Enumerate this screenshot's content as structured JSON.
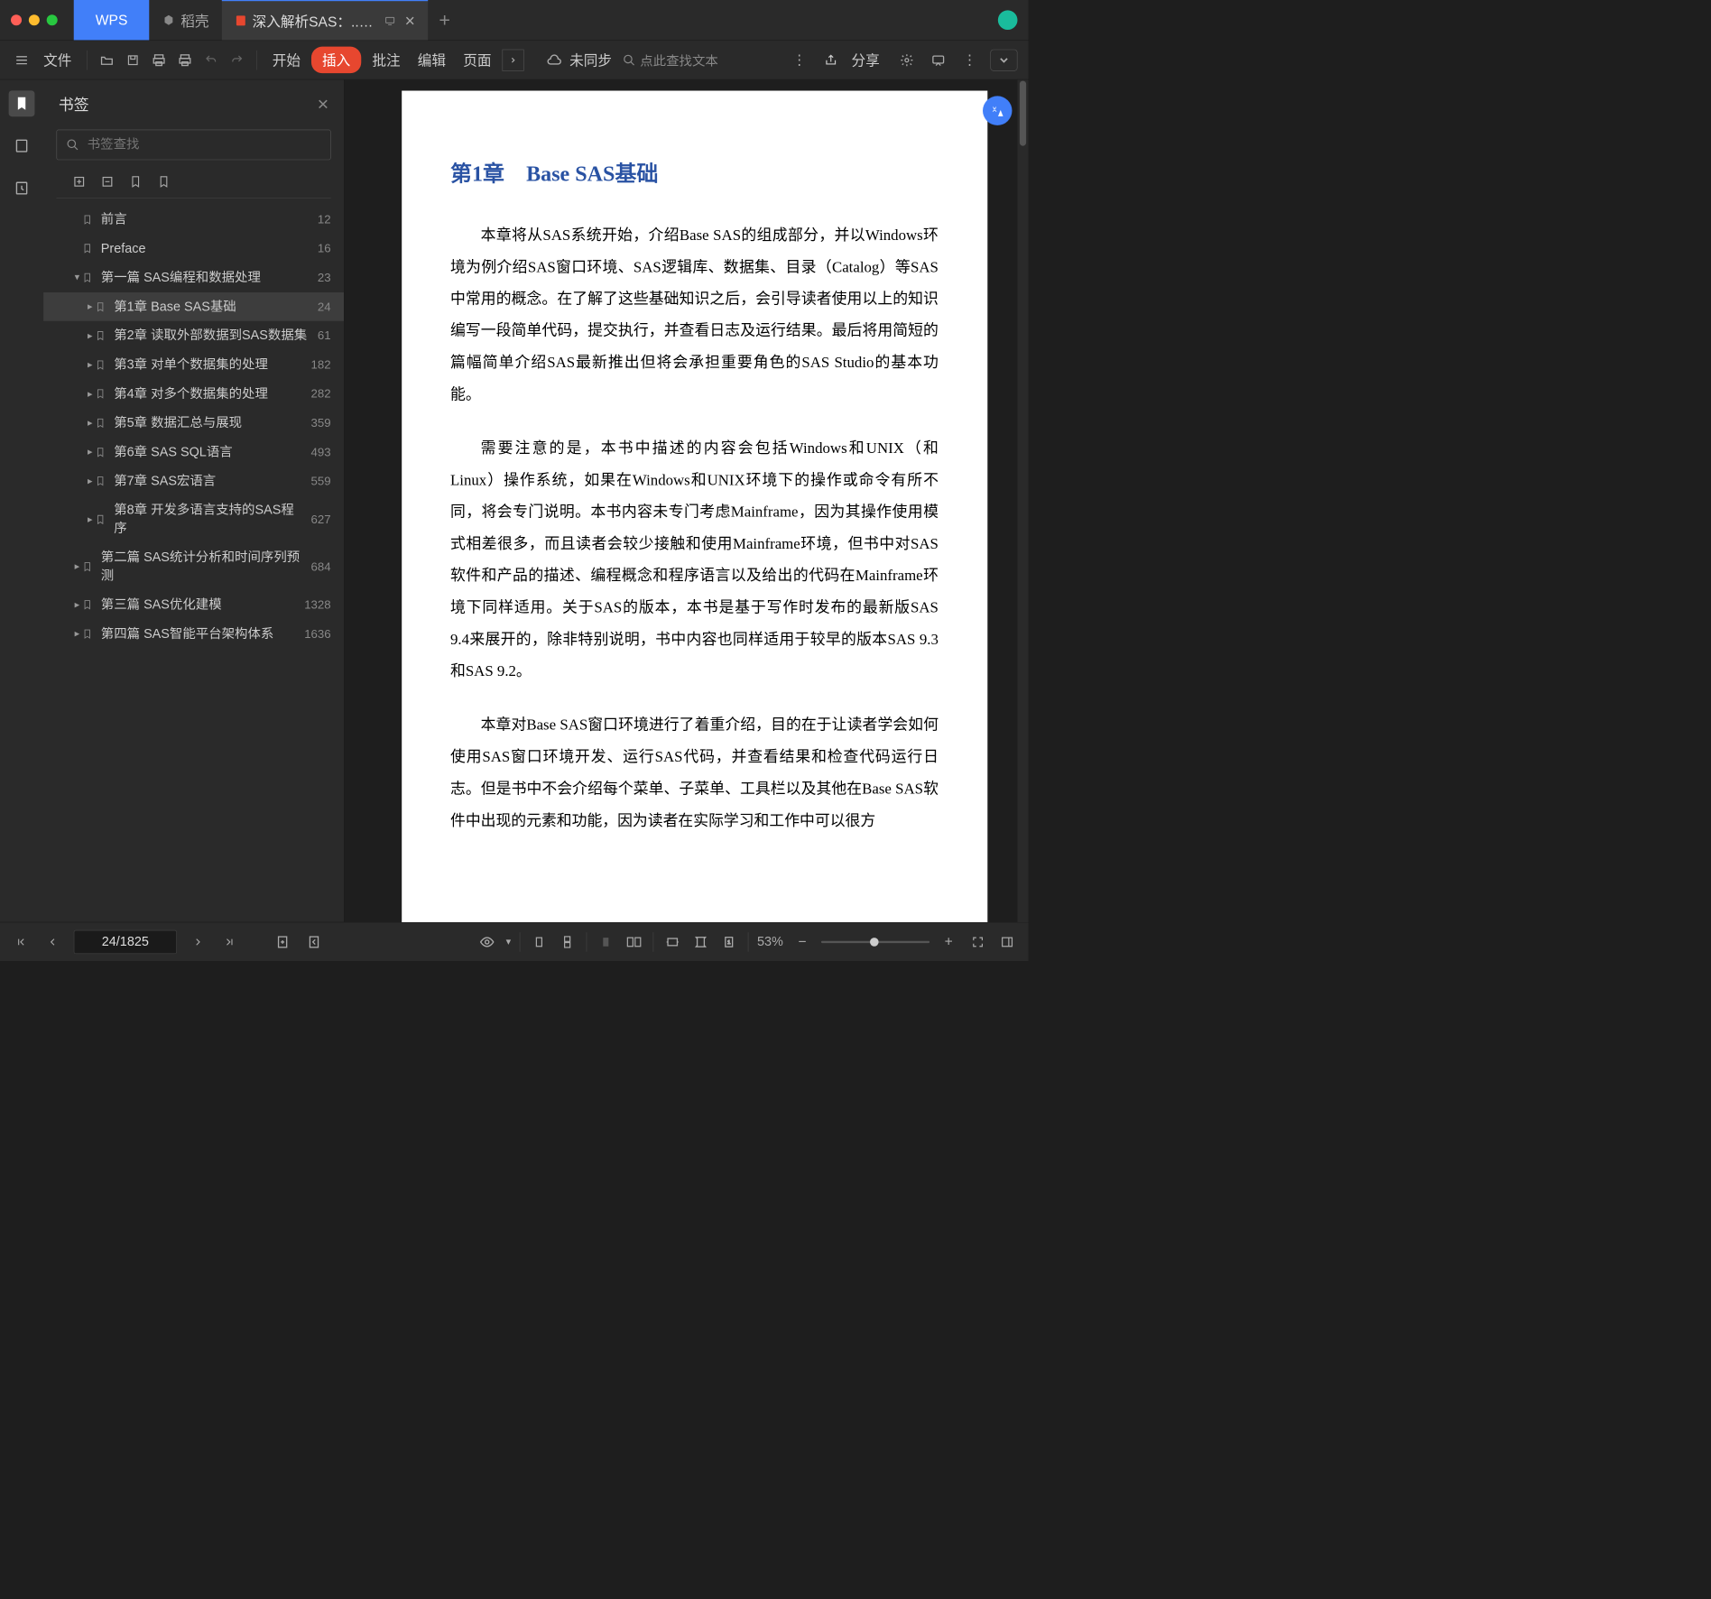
{
  "titlebar": {
    "wps_label": "WPS",
    "docer_label": "稻壳",
    "active_tab": "深入解析SAS：...业应用_.pdf"
  },
  "toolbar": {
    "file": "文件",
    "menu_start": "开始",
    "menu_insert": "插入",
    "menu_annotate": "批注",
    "menu_edit": "编辑",
    "menu_page": "页面",
    "unsync": "未同步",
    "search_placeholder": "点此查找文本",
    "share": "分享"
  },
  "panel": {
    "title": "书签",
    "search_placeholder": "书签查找"
  },
  "bookmarks": [
    {
      "label": "前言",
      "page": "12",
      "level": 0,
      "arrow": ""
    },
    {
      "label": "Preface",
      "page": "16",
      "level": 0,
      "arrow": ""
    },
    {
      "label": "第一篇 SAS编程和数据处理",
      "page": "23",
      "level": 0,
      "arrow": "▾"
    },
    {
      "label": "第1章 Base SAS基础",
      "page": "24",
      "level": 1,
      "arrow": "▸",
      "selected": true
    },
    {
      "label": "第2章 读取外部数据到SAS数据集",
      "page": "61",
      "level": 1,
      "arrow": "▸"
    },
    {
      "label": "第3章 对单个数据集的处理",
      "page": "182",
      "level": 1,
      "arrow": "▸"
    },
    {
      "label": "第4章 对多个数据集的处理",
      "page": "282",
      "level": 1,
      "arrow": "▸"
    },
    {
      "label": "第5章 数据汇总与展现",
      "page": "359",
      "level": 1,
      "arrow": "▸"
    },
    {
      "label": "第6章 SAS SQL语言",
      "page": "493",
      "level": 1,
      "arrow": "▸"
    },
    {
      "label": "第7章 SAS宏语言",
      "page": "559",
      "level": 1,
      "arrow": "▸"
    },
    {
      "label": "第8章 开发多语言支持的SAS程序",
      "page": "627",
      "level": 1,
      "arrow": "▸"
    },
    {
      "label": "第二篇 SAS统计分析和时间序列预测",
      "page": "684",
      "level": 0,
      "arrow": "▸"
    },
    {
      "label": "第三篇 SAS优化建模",
      "page": "1328",
      "level": 0,
      "arrow": "▸"
    },
    {
      "label": "第四篇 SAS智能平台架构体系",
      "page": "1636",
      "level": 0,
      "arrow": "▸"
    }
  ],
  "document": {
    "chapter_title": "第1章　Base SAS基础",
    "p1": "本章将从SAS系统开始，介绍Base SAS的组成部分，并以Windows环境为例介绍SAS窗口环境、SAS逻辑库、数据集、目录（Catalog）等SAS中常用的概念。在了解了这些基础知识之后，会引导读者使用以上的知识编写一段简单代码，提交执行，并查看日志及运行结果。最后将用简短的篇幅简单介绍SAS最新推出但将会承担重要角色的SAS Studio的基本功能。",
    "p2": "需要注意的是，本书中描述的内容会包括Windows和UNIX（和Linux）操作系统，如果在Windows和UNIX环境下的操作或命令有所不同，将会专门说明。本书内容未专门考虑Mainframe，因为其操作使用模式相差很多，而且读者会较少接触和使用Mainframe环境，但书中对SAS软件和产品的描述、编程概念和程序语言以及给出的代码在Mainframe环境下同样适用。关于SAS的版本，本书是基于写作时发布的最新版SAS 9.4来展开的，除非特别说明，书中内容也同样适用于较早的版本SAS 9.3和SAS 9.2。",
    "p3": "本章对Base SAS窗口环境进行了着重介绍，目的在于让读者学会如何使用SAS窗口环境开发、运行SAS代码，并查看结果和检查代码运行日志。但是书中不会介绍每个菜单、子菜单、工具栏以及其他在Base SAS软件中出现的元素和功能，因为读者在实际学习和工作中可以很方"
  },
  "statusbar": {
    "page_input": "24/1825",
    "zoom": "53%"
  }
}
